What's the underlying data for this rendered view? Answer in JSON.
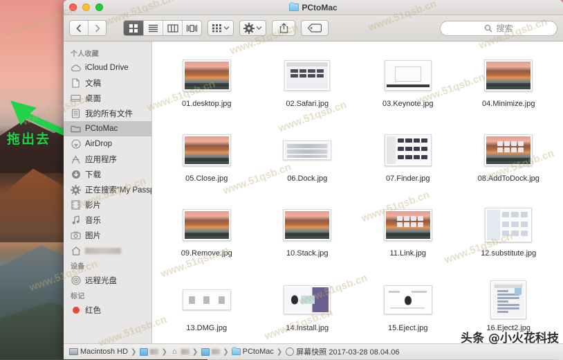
{
  "window": {
    "title": "PCtoMac",
    "traffic_lights": [
      "close",
      "minimize",
      "zoom"
    ]
  },
  "toolbar": {
    "back_icon": "chevron-left-icon",
    "forward_icon": "chevron-right-icon",
    "views": [
      {
        "name": "icon-view",
        "icon": "grid-icon",
        "active": true
      },
      {
        "name": "list-view",
        "icon": "list-icon",
        "active": false
      },
      {
        "name": "column-view",
        "icon": "columns-icon",
        "active": false
      },
      {
        "name": "cover-flow-view",
        "icon": "coverflow-icon",
        "active": false
      }
    ],
    "arrange_icon": "arrange-grid-icon",
    "action_icon": "gear-icon",
    "share_icon": "share-icon",
    "tag_icon": "tag-icon"
  },
  "search": {
    "placeholder": "搜索",
    "icon": "search-icon",
    "value": ""
  },
  "sidebar": {
    "sections": [
      {
        "header": "个人收藏",
        "items": [
          {
            "label": "iCloud Drive",
            "icon": "cloud-icon",
            "selected": false
          },
          {
            "label": "文稿",
            "icon": "documents-icon",
            "selected": false
          },
          {
            "label": "桌面",
            "icon": "desktop-icon",
            "selected": false
          },
          {
            "label": "我的所有文件",
            "icon": "all-my-files-icon",
            "selected": false
          },
          {
            "label": "PCtoMac",
            "icon": "folder-icon",
            "selected": true
          },
          {
            "label": "AirDrop",
            "icon": "airdrop-icon",
            "selected": false
          },
          {
            "label": "应用程序",
            "icon": "applications-icon",
            "selected": false
          },
          {
            "label": "下载",
            "icon": "downloads-icon",
            "selected": false
          },
          {
            "label": "正在搜索“My Passport”",
            "icon": "smart-folder-icon",
            "selected": false
          },
          {
            "label": "影片",
            "icon": "movies-icon",
            "selected": false
          },
          {
            "label": "音乐",
            "icon": "music-icon",
            "selected": false
          },
          {
            "label": "图片",
            "icon": "pictures-icon",
            "selected": false
          },
          {
            "label": "",
            "icon": "home-icon",
            "selected": false,
            "blurred": true
          }
        ]
      },
      {
        "header": "设备",
        "items": [
          {
            "label": "远程光盘",
            "icon": "remote-disc-icon",
            "selected": false
          }
        ]
      },
      {
        "header": "标记",
        "items": [
          {
            "label": "红色",
            "icon": "red-tag-icon",
            "selected": false
          }
        ]
      }
    ]
  },
  "files": [
    {
      "name": "01.desktop.jpg",
      "art": "wall"
    },
    {
      "name": "02.Safari.jpg",
      "art": "appwin"
    },
    {
      "name": "03.Keynote.jpg",
      "art": "white"
    },
    {
      "name": "04.Minimize.jpg",
      "art": "wall"
    },
    {
      "name": "05.Close.jpg",
      "art": "wall"
    },
    {
      "name": "06.Dock.jpg",
      "art": "dockstrip"
    },
    {
      "name": "07.Finder.jpg",
      "art": "finderwin"
    },
    {
      "name": "08.AddToDock.jpg",
      "art": "wall-icons"
    },
    {
      "name": "09.Remove.jpg",
      "art": "wall"
    },
    {
      "name": "10.Stack.jpg",
      "art": "wall"
    },
    {
      "name": "11.Link.jpg",
      "art": "wall-icons"
    },
    {
      "name": "12.substitute.jpg",
      "art": "prefs"
    },
    {
      "name": "13.DMG.jpg",
      "art": "dmg"
    },
    {
      "name": "14.Install.jpg",
      "art": "installer"
    },
    {
      "name": "15.Eject.jpg",
      "art": "eject"
    },
    {
      "name": "16.Eject2.jpg",
      "art": "dialog"
    }
  ],
  "pathbar": [
    {
      "label": "Macintosh HD",
      "icon": "hard-disk-icon",
      "blurred": false
    },
    {
      "label": "",
      "icon": "blue-folder-icon",
      "blurred": true
    },
    {
      "label": "",
      "icon": "home-icon",
      "blurred": true
    },
    {
      "label": "",
      "icon": "blue-folder-icon",
      "blurred": true
    },
    {
      "label": "PCtoMac",
      "icon": "folder-icon",
      "blurred": false
    },
    {
      "label": "屏幕快照 2017-03-28 08.04.06",
      "icon": "screenshot-icon",
      "blurred": false
    }
  ],
  "annotation": {
    "text": "拖出去",
    "arrow_color": "#22d24a",
    "arrow_icon": "arrow-up-left-icon"
  },
  "watermarks": {
    "site": "www.51qsb.cn",
    "byline": "头条 @小火花科技"
  }
}
